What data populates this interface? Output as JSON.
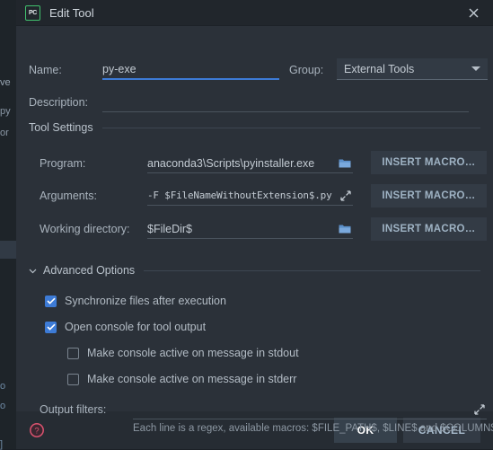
{
  "window": {
    "title": "Edit Tool",
    "logo_text": "PC",
    "logo_name": "pycharm-logo-icon",
    "close_label": "✕"
  },
  "form": {
    "name": {
      "label": "Name:",
      "value": "py-exe",
      "focused": true
    },
    "group": {
      "label": "Group:",
      "value": "External Tools",
      "options": [
        "External Tools"
      ]
    },
    "description": {
      "label": "Description:",
      "value": ""
    }
  },
  "tool_settings": {
    "section_title": "Tool Settings",
    "program": {
      "label": "Program:",
      "value": "anaconda3\\Scripts\\pyinstaller.exe",
      "button": "INSERT MACRO…"
    },
    "arguments": {
      "label": "Arguments:",
      "value": "-F $FileNameWithoutExtension$.py",
      "button": "INSERT MACRO…"
    },
    "working_directory": {
      "label": "Working directory:",
      "value": "$FileDir$",
      "button": "INSERT MACRO…"
    }
  },
  "advanced_options": {
    "section_title": "Advanced Options",
    "expanded": true,
    "checkboxes": [
      {
        "label": "Synchronize files after execution",
        "checked": true
      },
      {
        "label": "Open console for tool output",
        "checked": true
      },
      {
        "label": "Make console active on message in stdout",
        "checked": false
      },
      {
        "label": "Make console active on message in stderr",
        "checked": false
      }
    ],
    "output_filters": {
      "label": "Output filters:",
      "value": "",
      "hint": "Each line is a regex, available macros: $FILE_PATH$, $LINE$ and $COLUMN$"
    }
  },
  "footer": {
    "help_name": "help-icon",
    "ok": "OK",
    "cancel": "CANCEL"
  },
  "background_strip": {
    "fragments": [
      "ve",
      "py",
      "or",
      "o",
      "o",
      "]"
    ]
  },
  "colors": {
    "dialog_bg": "#2b3139",
    "titlebar_bg": "#21262c",
    "footer_bg": "#262c33",
    "accent_blue": "#3d7bd6",
    "logo_green": "#41c16e",
    "help_red": "#d9536f",
    "text": "#b4bdc6"
  }
}
